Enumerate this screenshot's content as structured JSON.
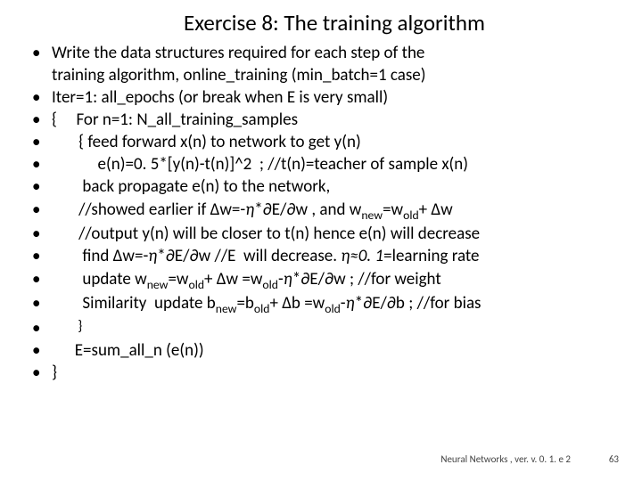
{
  "title": "Exercise 8: The training algorithm",
  "lines": {
    "l0a": "Write the data structures required for each step of the",
    "l0b": "training algorithm, online_training (min_batch=1 case)",
    "l1": "Iter=1: all_epochs (or break when E is very small)",
    "l2": "{     For n=1: N_all_training_samples",
    "l3": "       { feed forward x(n) to network to get y(n)",
    "l4": "            e(n)=0. 5*[y(n)-t(n)]^2  ; //t(n)=teacher of sample x(n)",
    "l5": "        back propagate e(n) to the network,",
    "l6a": "       //showed earlier if Δw=-",
    "l6b": "*∂E/∂w , and w",
    "l6c": "=w",
    "l6d": "+ Δw",
    "l7": "       //output y(n) will be closer to t(n) hence e(n) will decrease",
    "l8a": "        find Δw=-",
    "l8b": "*∂E/∂w //E  will decrease. ",
    "l8c": "0. 1",
    "l8d": "=learning rate",
    "l9a": "        update w",
    "l9b": "=w",
    "l9c": "+ Δw =w",
    "l9d": "-",
    "l9e": "*∂E/∂w ; //for weight",
    "l10a": "        Similarity  update b",
    "l10b": "=b",
    "l10c": "+ Δb =w",
    "l10d": "-",
    "l10e": "*∂E/∂b ; //for bias",
    "l11": "        }",
    "l12": "      E=sum_all_n (e(n))",
    "l13": "}",
    "sub_new": "new",
    "sub_old": "old",
    "eta": "η",
    "approx": "≈"
  },
  "footer": "Neural Networks , ver. v. 0. 1. e 2",
  "page": "63"
}
